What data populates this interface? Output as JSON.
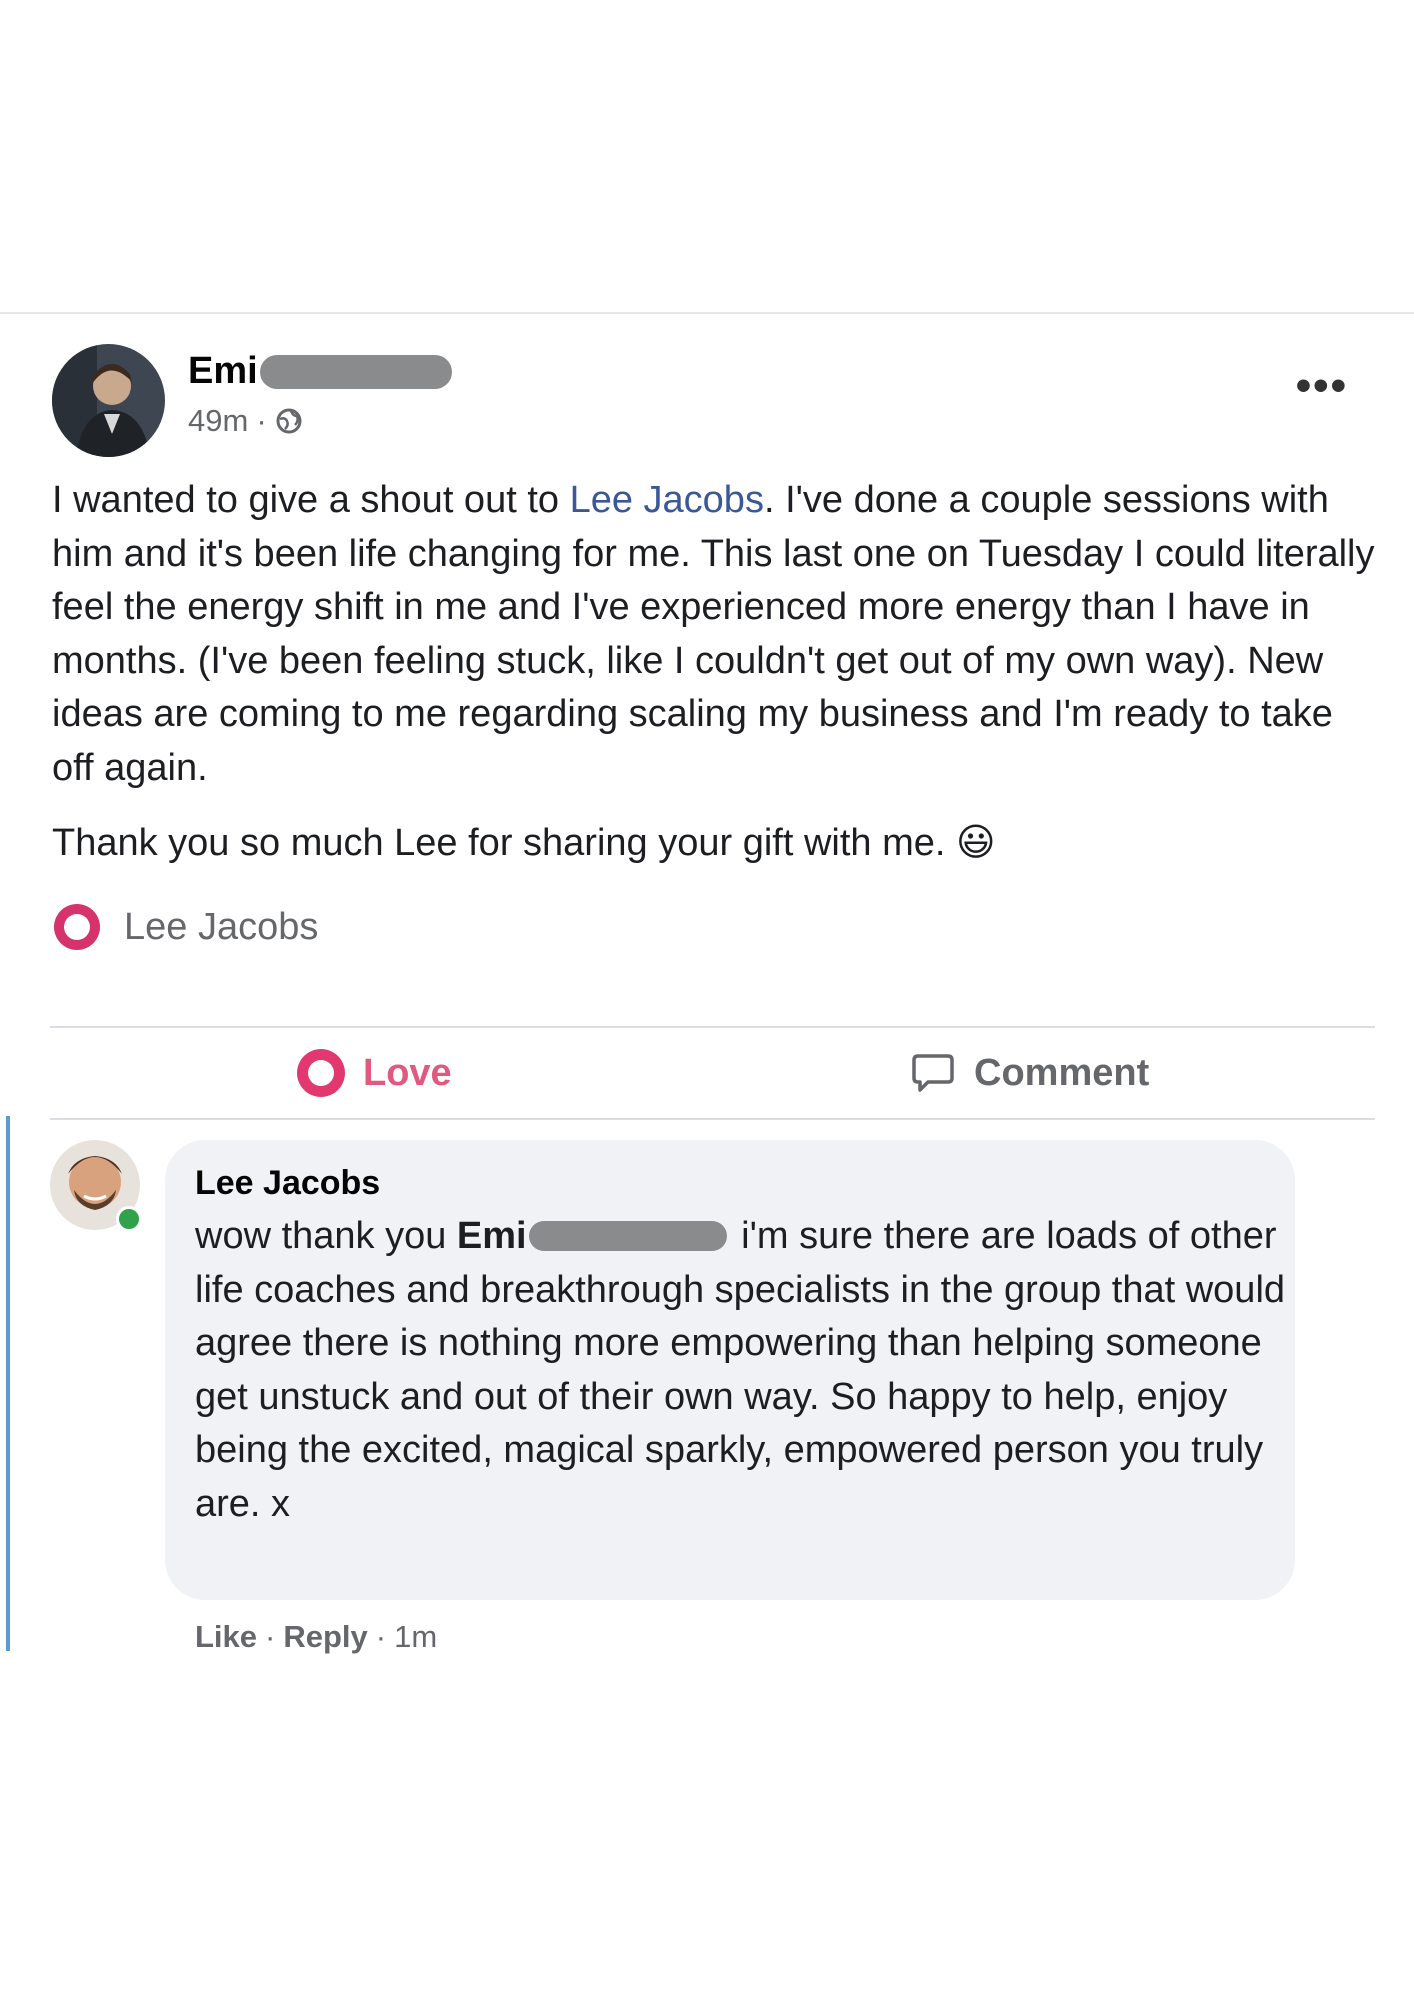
{
  "post": {
    "author_name": "Emi",
    "time": "49m",
    "separator": "·",
    "body": {
      "p1_before_mention": "I wanted to give a shout out to ",
      "mention": "Lee Jacobs",
      "p1_after_mention": ". I've done a couple sessions with him and it's been life changing for me. This last one on Tuesday I could literally feel the energy shift in me and I've experienced more energy than I have in months. (I've been feeling stuck, like I couldn't get out of my own way). New ideas are coming to me regarding scaling my business and I'm ready to take off again.",
      "p2": "Thank you so much Lee for sharing your gift with me. 😃"
    },
    "reactions": {
      "names": "Lee Jacobs"
    },
    "actions": {
      "love_label": "Love",
      "comment_label": "Comment"
    },
    "more_label": "•••"
  },
  "comment": {
    "author_name": "Lee Jacobs",
    "text_before": "wow thank you ",
    "mention_name": "Emi",
    "text_after": " i'm sure there are loads of other life coaches and breakthrough specialists in the group that would agree there is nothing more empowering than helping someone get unstuck and out of their own way. So happy to help, enjoy being the excited, magical sparkly, empowered person you truly are. x",
    "footer": {
      "like_label": "Like",
      "reply_label": "Reply",
      "time": "1m",
      "separator": "·"
    }
  },
  "colors": {
    "mention": "#385898",
    "love": "#e2386f",
    "secondary_text": "#65676b",
    "bubble": "#f0f2f5",
    "thread_line": "#5b9bd5",
    "online": "#31a24c"
  },
  "icons": {
    "post_avatar": "profile-photo",
    "privacy": "globe-icon",
    "more": "more-options-icon",
    "reaction": "love-icon",
    "love_action": "love-icon",
    "comment_action": "comment-icon",
    "comment_avatar": "profile-photo"
  }
}
